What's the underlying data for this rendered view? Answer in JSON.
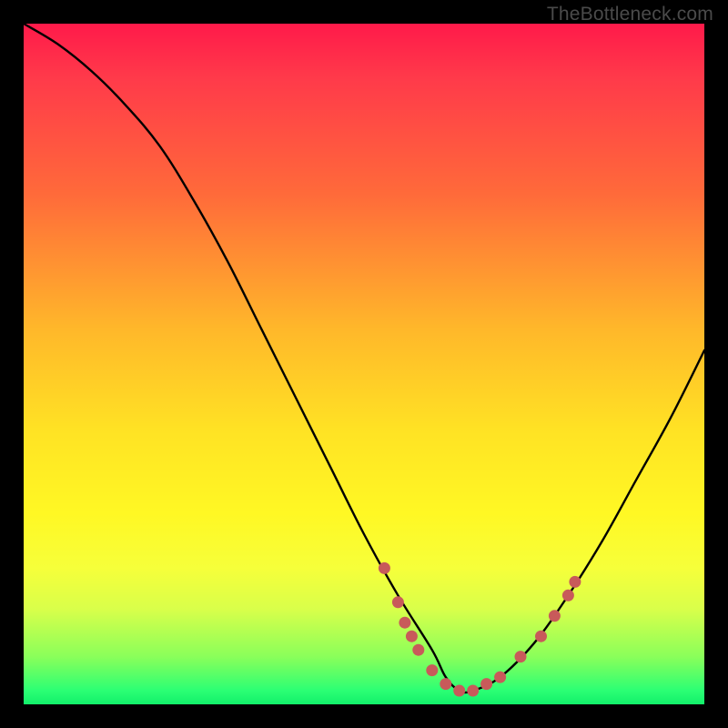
{
  "watermark": "TheBottleneck.com",
  "chart_data": {
    "type": "line",
    "title": "",
    "xlabel": "",
    "ylabel": "",
    "xlim": [
      0,
      100
    ],
    "ylim": [
      0,
      100
    ],
    "grid": false,
    "legend": false,
    "series": [
      {
        "name": "bottleneck-curve",
        "x": [
          0,
          5,
          10,
          15,
          20,
          25,
          30,
          35,
          40,
          45,
          50,
          55,
          60,
          62,
          64,
          66,
          70,
          75,
          80,
          85,
          90,
          95,
          100
        ],
        "y": [
          100,
          97,
          93,
          88,
          82,
          74,
          65,
          55,
          45,
          35,
          25,
          16,
          8,
          4,
          2,
          2,
          4,
          9,
          16,
          24,
          33,
          42,
          52
        ]
      }
    ],
    "markers": [
      {
        "x": 53,
        "y": 20
      },
      {
        "x": 55,
        "y": 15
      },
      {
        "x": 56,
        "y": 12
      },
      {
        "x": 57,
        "y": 10
      },
      {
        "x": 58,
        "y": 8
      },
      {
        "x": 60,
        "y": 5
      },
      {
        "x": 62,
        "y": 3
      },
      {
        "x": 64,
        "y": 2
      },
      {
        "x": 66,
        "y": 2
      },
      {
        "x": 68,
        "y": 3
      },
      {
        "x": 70,
        "y": 4
      },
      {
        "x": 73,
        "y": 7
      },
      {
        "x": 76,
        "y": 10
      },
      {
        "x": 78,
        "y": 13
      },
      {
        "x": 80,
        "y": 16
      },
      {
        "x": 81,
        "y": 18
      }
    ],
    "colors": {
      "curve": "#000000",
      "marker_fill": "#c85a5a",
      "marker_stroke": "#c85a5a",
      "gradient_top": "#ff1a4a",
      "gradient_mid": "#ffe324",
      "gradient_bottom": "#12f06a"
    }
  }
}
